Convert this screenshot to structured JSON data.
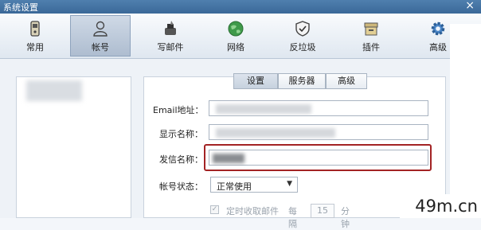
{
  "window": {
    "title": "系统设置",
    "close_glyph": "×"
  },
  "toolbar": {
    "items": [
      {
        "label": "常用",
        "icon": "phone-icon"
      },
      {
        "label": "帐号",
        "icon": "user-icon",
        "active": true
      },
      {
        "label": "写邮件",
        "icon": "inkwell-icon"
      },
      {
        "label": "网络",
        "icon": "globe-icon"
      },
      {
        "label": "反垃圾",
        "icon": "shield-icon"
      },
      {
        "label": "插件",
        "icon": "box-icon"
      },
      {
        "label": "高级",
        "icon": "gear-icon"
      }
    ]
  },
  "tabs": [
    {
      "label": "设置",
      "active": true
    },
    {
      "label": "服务器"
    },
    {
      "label": "高级"
    }
  ],
  "form": {
    "email_label": "Email地址：",
    "display_name_label": "显示名称：",
    "sender_name_label": "发信名称：",
    "status_label": "帐号状态：",
    "status_value": "正常使用",
    "auto_fetch_label": "定时收取邮件",
    "interval_prefix": "每隔",
    "interval_value": "15",
    "interval_unit": "分钟"
  },
  "watermark": "49m.cn",
  "colors": {
    "highlight": "#a32324",
    "titlebar": "#3a6898"
  }
}
